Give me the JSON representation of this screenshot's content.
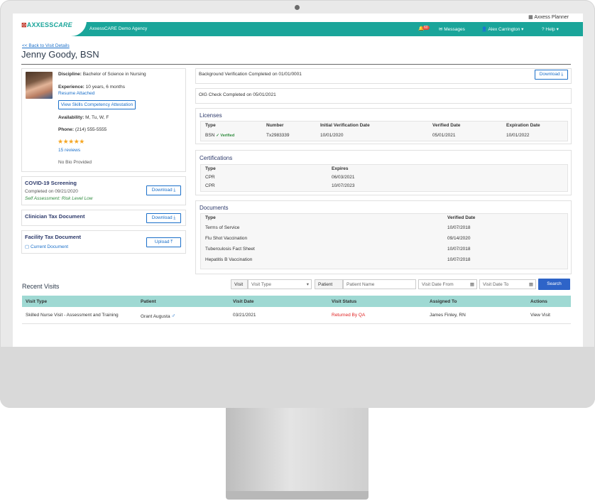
{
  "header": {
    "planner_label": "Axxess Planner",
    "logo_text": "AXXESS",
    "logo_care": "CARE",
    "agency": "AxxessCARE Demo Agency",
    "notification_count": "60",
    "messages_label": "Messages",
    "user_label": "Alex Carrington",
    "help_label": "Help"
  },
  "page": {
    "back_link": "<< Back to Visit Details",
    "title": "Jenny Goody, BSN"
  },
  "profile": {
    "discipline_label": "Discipline:",
    "discipline_value": "Bachelor of Science in Nursing",
    "experience_label": "Experience:",
    "experience_value": "10 years, 6 months",
    "resume_link": "Resume Attached",
    "attestation_button": "View Skills Competency Attestation",
    "availability_label": "Availability:",
    "availability_value": "M, Tu, W, F",
    "phone_label": "Phone:",
    "phone_value": "(214) 555-5555",
    "stars": "★★★★★",
    "rating": 5,
    "reviews_link": "15 reviews",
    "bio": "No Bio Provided"
  },
  "covid": {
    "title": "COVID-19 Screening",
    "completed": "Completed on 09/21/2020",
    "assessment": "Self Assessment: Risk Level Low",
    "button": "Download"
  },
  "clinician_tax": {
    "title": "Clinician Tax Document",
    "button": "Download"
  },
  "facility_tax": {
    "title": "Facility Tax Document",
    "link": "Current Document",
    "button": "Upload"
  },
  "background": {
    "text": "Background Verification Completed on 01/01/0001",
    "button": "Download"
  },
  "oig": {
    "text": "OIG Check Completed on 05/01/2021"
  },
  "licenses": {
    "title": "Licenses",
    "headers": [
      "Type",
      "Number",
      "Initial Verification Date",
      "Verified Date",
      "Expiration Date"
    ],
    "row": {
      "type": "BSN",
      "verified_tag": "✓ Verified",
      "number": "Tx2983339",
      "initial": "10/01/2020",
      "verified": "05/01/2021",
      "expiration": "10/01/2022"
    }
  },
  "certifications": {
    "title": "Certifications",
    "headers": [
      "Type",
      "Expires"
    ],
    "rows": [
      {
        "type": "CPR",
        "expires": "06/03/2021"
      },
      {
        "type": "CPR",
        "expires": "10/07/2023"
      }
    ]
  },
  "documents": {
    "title": "Documents",
    "headers": [
      "Type",
      "Verified Date"
    ],
    "rows": [
      {
        "type": "Terms of Service",
        "date": "10/07/2018"
      },
      {
        "type": "Flu Shot Vaccination",
        "date": "09/14/2020"
      },
      {
        "type": "Tuberculosis Fact Sheet",
        "date": "10/07/2018"
      },
      {
        "type": "Hepatitis B Vaccination",
        "date": "10/07/2018"
      }
    ]
  },
  "recent_visits": {
    "title": "Recent Visits",
    "filter_visit_label": "Visit",
    "filter_visit_type": "Visit Type",
    "filter_patient_label": "Patient",
    "filter_patient_placeholder": "Patient Name",
    "date_from": "Visit Date From",
    "date_to": "Visit Date To",
    "search_button": "Search",
    "headers": [
      "Visit Type",
      "Patient",
      "Visit Date",
      "Visit Status",
      "Assigned To",
      "Actions"
    ],
    "row": {
      "visit_type": "Skilled Nurse Visit - Assessment and Training",
      "patient": "Grant Augusta",
      "visit_date": "03/21/2021",
      "status": "Returned By QA",
      "assigned_to": "James Finley, RN",
      "action": "View Visit"
    }
  },
  "colors": {
    "teal": "#1aa59a",
    "table_header": "#9fd9d3",
    "link": "#1a6fc9",
    "status_red": "#e02424",
    "search_blue": "#2e64c8",
    "star": "#f5a623"
  }
}
